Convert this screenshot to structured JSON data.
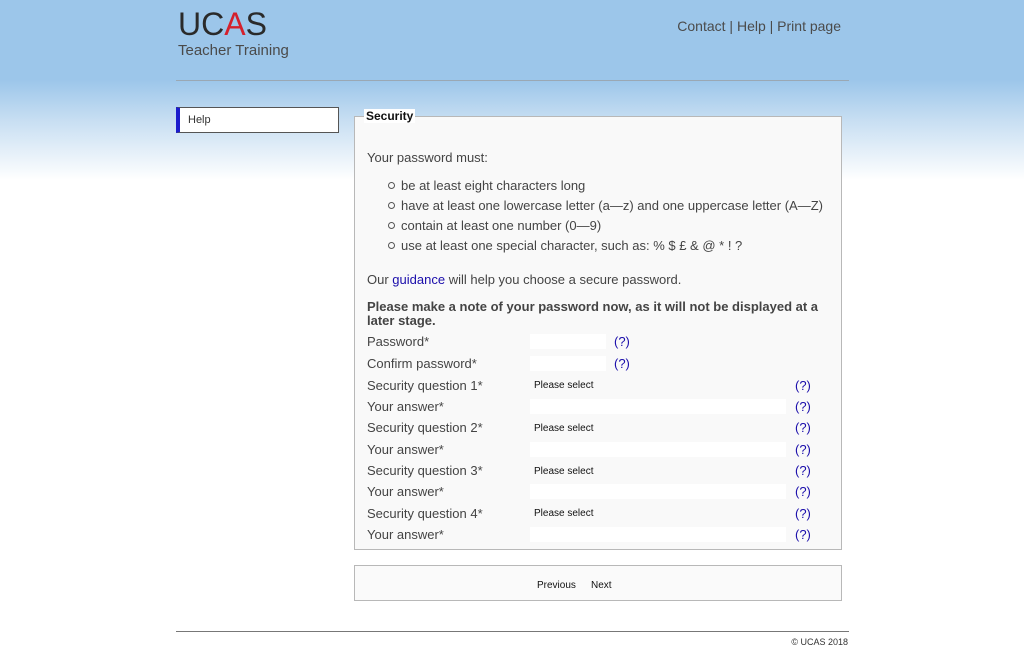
{
  "header": {
    "logo_main_pre": "UC",
    "logo_main_accent": "A",
    "logo_main_post": "S",
    "logo_sub": "Teacher Training",
    "links": [
      "Contact",
      "Help",
      "Print page"
    ],
    "separator": "|"
  },
  "sidebar": {
    "items": [
      {
        "label": "Help"
      }
    ]
  },
  "section": {
    "title": "Security",
    "intro": "Your password must:",
    "rules": [
      "be at least eight characters long",
      "have at least one lowercase letter (a—z) and one uppercase letter (A—Z)",
      "contain at least one number (0—9)",
      "use at least one special character, such as: % $ £ & @ * ! ?"
    ],
    "guidance_pre": "Our ",
    "guidance_link": "guidance",
    "guidance_post": " will help you choose a secure password.",
    "note_line1": "Please make a note of your password now, as it will not be displayed at a",
    "note_line2": "later stage."
  },
  "form": {
    "help_text": "(?)",
    "password_label": "Password*",
    "confirm_label": "Confirm password*",
    "questions": [
      {
        "label": "Security question 1*",
        "selected": "Please select",
        "answer_label": "Your answer*"
      },
      {
        "label": "Security question 2*",
        "selected": "Please select",
        "answer_label": "Your answer*"
      },
      {
        "label": "Security question 3*",
        "selected": "Please select",
        "answer_label": "Your answer*"
      },
      {
        "label": "Security question 4*",
        "selected": "Please select",
        "answer_label": "Your answer*"
      }
    ]
  },
  "nav": {
    "previous": "Previous",
    "next": "Next"
  },
  "footer": {
    "copyright": "© UCAS 2018"
  },
  "colors": {
    "accent_red": "#d4202c",
    "link_blue": "#1a0dab",
    "sidebar_marker": "#1c1ccc"
  }
}
